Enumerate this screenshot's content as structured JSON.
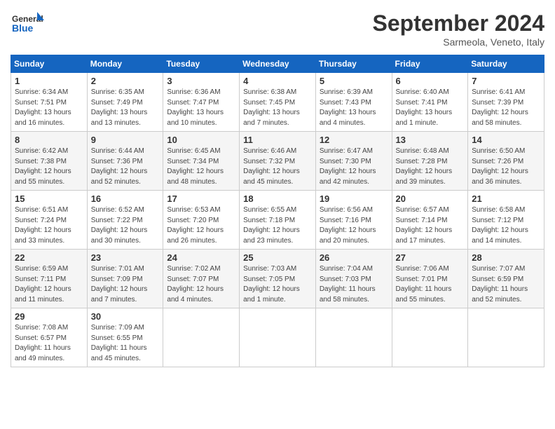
{
  "header": {
    "logo_line1": "General",
    "logo_line2": "Blue",
    "month_title": "September 2024",
    "location": "Sarmeola, Veneto, Italy"
  },
  "weekdays": [
    "Sunday",
    "Monday",
    "Tuesday",
    "Wednesday",
    "Thursday",
    "Friday",
    "Saturday"
  ],
  "weeks": [
    [
      {
        "day": "1",
        "info": "Sunrise: 6:34 AM\nSunset: 7:51 PM\nDaylight: 13 hours\nand 16 minutes."
      },
      {
        "day": "2",
        "info": "Sunrise: 6:35 AM\nSunset: 7:49 PM\nDaylight: 13 hours\nand 13 minutes."
      },
      {
        "day": "3",
        "info": "Sunrise: 6:36 AM\nSunset: 7:47 PM\nDaylight: 13 hours\nand 10 minutes."
      },
      {
        "day": "4",
        "info": "Sunrise: 6:38 AM\nSunset: 7:45 PM\nDaylight: 13 hours\nand 7 minutes."
      },
      {
        "day": "5",
        "info": "Sunrise: 6:39 AM\nSunset: 7:43 PM\nDaylight: 13 hours\nand 4 minutes."
      },
      {
        "day": "6",
        "info": "Sunrise: 6:40 AM\nSunset: 7:41 PM\nDaylight: 13 hours\nand 1 minute."
      },
      {
        "day": "7",
        "info": "Sunrise: 6:41 AM\nSunset: 7:39 PM\nDaylight: 12 hours\nand 58 minutes."
      }
    ],
    [
      {
        "day": "8",
        "info": "Sunrise: 6:42 AM\nSunset: 7:38 PM\nDaylight: 12 hours\nand 55 minutes."
      },
      {
        "day": "9",
        "info": "Sunrise: 6:44 AM\nSunset: 7:36 PM\nDaylight: 12 hours\nand 52 minutes."
      },
      {
        "day": "10",
        "info": "Sunrise: 6:45 AM\nSunset: 7:34 PM\nDaylight: 12 hours\nand 48 minutes."
      },
      {
        "day": "11",
        "info": "Sunrise: 6:46 AM\nSunset: 7:32 PM\nDaylight: 12 hours\nand 45 minutes."
      },
      {
        "day": "12",
        "info": "Sunrise: 6:47 AM\nSunset: 7:30 PM\nDaylight: 12 hours\nand 42 minutes."
      },
      {
        "day": "13",
        "info": "Sunrise: 6:48 AM\nSunset: 7:28 PM\nDaylight: 12 hours\nand 39 minutes."
      },
      {
        "day": "14",
        "info": "Sunrise: 6:50 AM\nSunset: 7:26 PM\nDaylight: 12 hours\nand 36 minutes."
      }
    ],
    [
      {
        "day": "15",
        "info": "Sunrise: 6:51 AM\nSunset: 7:24 PM\nDaylight: 12 hours\nand 33 minutes."
      },
      {
        "day": "16",
        "info": "Sunrise: 6:52 AM\nSunset: 7:22 PM\nDaylight: 12 hours\nand 30 minutes."
      },
      {
        "day": "17",
        "info": "Sunrise: 6:53 AM\nSunset: 7:20 PM\nDaylight: 12 hours\nand 26 minutes."
      },
      {
        "day": "18",
        "info": "Sunrise: 6:55 AM\nSunset: 7:18 PM\nDaylight: 12 hours\nand 23 minutes."
      },
      {
        "day": "19",
        "info": "Sunrise: 6:56 AM\nSunset: 7:16 PM\nDaylight: 12 hours\nand 20 minutes."
      },
      {
        "day": "20",
        "info": "Sunrise: 6:57 AM\nSunset: 7:14 PM\nDaylight: 12 hours\nand 17 minutes."
      },
      {
        "day": "21",
        "info": "Sunrise: 6:58 AM\nSunset: 7:12 PM\nDaylight: 12 hours\nand 14 minutes."
      }
    ],
    [
      {
        "day": "22",
        "info": "Sunrise: 6:59 AM\nSunset: 7:11 PM\nDaylight: 12 hours\nand 11 minutes."
      },
      {
        "day": "23",
        "info": "Sunrise: 7:01 AM\nSunset: 7:09 PM\nDaylight: 12 hours\nand 7 minutes."
      },
      {
        "day": "24",
        "info": "Sunrise: 7:02 AM\nSunset: 7:07 PM\nDaylight: 12 hours\nand 4 minutes."
      },
      {
        "day": "25",
        "info": "Sunrise: 7:03 AM\nSunset: 7:05 PM\nDaylight: 12 hours\nand 1 minute."
      },
      {
        "day": "26",
        "info": "Sunrise: 7:04 AM\nSunset: 7:03 PM\nDaylight: 11 hours\nand 58 minutes."
      },
      {
        "day": "27",
        "info": "Sunrise: 7:06 AM\nSunset: 7:01 PM\nDaylight: 11 hours\nand 55 minutes."
      },
      {
        "day": "28",
        "info": "Sunrise: 7:07 AM\nSunset: 6:59 PM\nDaylight: 11 hours\nand 52 minutes."
      }
    ],
    [
      {
        "day": "29",
        "info": "Sunrise: 7:08 AM\nSunset: 6:57 PM\nDaylight: 11 hours\nand 49 minutes."
      },
      {
        "day": "30",
        "info": "Sunrise: 7:09 AM\nSunset: 6:55 PM\nDaylight: 11 hours\nand 45 minutes."
      },
      {
        "day": "",
        "info": ""
      },
      {
        "day": "",
        "info": ""
      },
      {
        "day": "",
        "info": ""
      },
      {
        "day": "",
        "info": ""
      },
      {
        "day": "",
        "info": ""
      }
    ]
  ]
}
